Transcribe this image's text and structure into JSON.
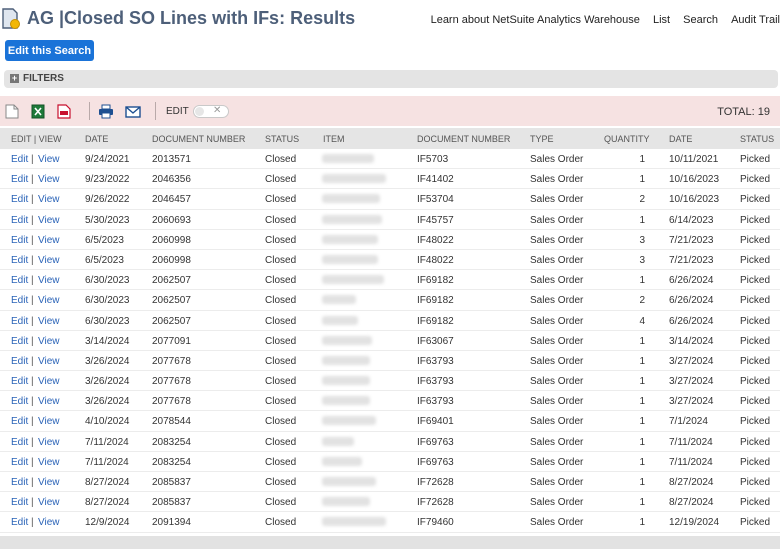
{
  "header": {
    "title": "AG |Closed SO Lines with IFs: Results",
    "links": [
      "Learn about NetSuite Analytics Warehouse",
      "List",
      "Search",
      "Audit Trail"
    ]
  },
  "edit_search_label": "Edit this Search",
  "filters_label": "FILTERS",
  "toolbar": {
    "edit_label": "EDIT",
    "total_label": "TOTAL: 19",
    "icons": [
      "new-page-icon",
      "excel-export-icon",
      "pdf-export-icon",
      "print-icon",
      "email-icon"
    ]
  },
  "columns": [
    "EDIT | VIEW",
    "DATE",
    "DOCUMENT NUMBER",
    "STATUS",
    "ITEM",
    "DOCUMENT NUMBER",
    "TYPE",
    "QUANTITY",
    "DATE",
    "STATUS"
  ],
  "row_edit": "Edit",
  "row_sep": "|",
  "row_view": "View",
  "rows": [
    {
      "date": "9/24/2021",
      "doc": "2013571",
      "status": "Closed",
      "if": "IF5703",
      "type": "Sales Order",
      "qty": "1",
      "date2": "10/11/2021",
      "status2": "Picked"
    },
    {
      "date": "9/23/2022",
      "doc": "2046356",
      "status": "Closed",
      "if": "IF41402",
      "type": "Sales Order",
      "qty": "1",
      "date2": "10/16/2023",
      "status2": "Picked"
    },
    {
      "date": "9/26/2022",
      "doc": "2046457",
      "status": "Closed",
      "if": "IF53704",
      "type": "Sales Order",
      "qty": "2",
      "date2": "10/16/2023",
      "status2": "Picked"
    },
    {
      "date": "5/30/2023",
      "doc": "2060693",
      "status": "Closed",
      "if": "IF45757",
      "type": "Sales Order",
      "qty": "1",
      "date2": "6/14/2023",
      "status2": "Picked"
    },
    {
      "date": "6/5/2023",
      "doc": "2060998",
      "status": "Closed",
      "if": "IF48022",
      "type": "Sales Order",
      "qty": "3",
      "date2": "7/21/2023",
      "status2": "Picked"
    },
    {
      "date": "6/5/2023",
      "doc": "2060998",
      "status": "Closed",
      "if": "IF48022",
      "type": "Sales Order",
      "qty": "3",
      "date2": "7/21/2023",
      "status2": "Picked"
    },
    {
      "date": "6/30/2023",
      "doc": "2062507",
      "status": "Closed",
      "if": "IF69182",
      "type": "Sales Order",
      "qty": "1",
      "date2": "6/26/2024",
      "status2": "Picked"
    },
    {
      "date": "6/30/2023",
      "doc": "2062507",
      "status": "Closed",
      "if": "IF69182",
      "type": "Sales Order",
      "qty": "2",
      "date2": "6/26/2024",
      "status2": "Picked"
    },
    {
      "date": "6/30/2023",
      "doc": "2062507",
      "status": "Closed",
      "if": "IF69182",
      "type": "Sales Order",
      "qty": "4",
      "date2": "6/26/2024",
      "status2": "Picked"
    },
    {
      "date": "3/14/2024",
      "doc": "2077091",
      "status": "Closed",
      "if": "IF63067",
      "type": "Sales Order",
      "qty": "1",
      "date2": "3/14/2024",
      "status2": "Picked"
    },
    {
      "date": "3/26/2024",
      "doc": "2077678",
      "status": "Closed",
      "if": "IF63793",
      "type": "Sales Order",
      "qty": "1",
      "date2": "3/27/2024",
      "status2": "Picked"
    },
    {
      "date": "3/26/2024",
      "doc": "2077678",
      "status": "Closed",
      "if": "IF63793",
      "type": "Sales Order",
      "qty": "1",
      "date2": "3/27/2024",
      "status2": "Picked"
    },
    {
      "date": "3/26/2024",
      "doc": "2077678",
      "status": "Closed",
      "if": "IF63793",
      "type": "Sales Order",
      "qty": "1",
      "date2": "3/27/2024",
      "status2": "Picked"
    },
    {
      "date": "4/10/2024",
      "doc": "2078544",
      "status": "Closed",
      "if": "IF69401",
      "type": "Sales Order",
      "qty": "1",
      "date2": "7/1/2024",
      "status2": "Picked"
    },
    {
      "date": "7/11/2024",
      "doc": "2083254",
      "status": "Closed",
      "if": "IF69763",
      "type": "Sales Order",
      "qty": "1",
      "date2": "7/11/2024",
      "status2": "Picked"
    },
    {
      "date": "7/11/2024",
      "doc": "2083254",
      "status": "Closed",
      "if": "IF69763",
      "type": "Sales Order",
      "qty": "1",
      "date2": "7/11/2024",
      "status2": "Picked"
    },
    {
      "date": "8/27/2024",
      "doc": "2085837",
      "status": "Closed",
      "if": "IF72628",
      "type": "Sales Order",
      "qty": "1",
      "date2": "8/27/2024",
      "status2": "Picked"
    },
    {
      "date": "8/27/2024",
      "doc": "2085837",
      "status": "Closed",
      "if": "IF72628",
      "type": "Sales Order",
      "qty": "1",
      "date2": "8/27/2024",
      "status2": "Picked"
    },
    {
      "date": "12/9/2024",
      "doc": "2091394",
      "status": "Closed",
      "if": "IF79460",
      "type": "Sales Order",
      "qty": "1",
      "date2": "12/19/2024",
      "status2": "Picked"
    }
  ]
}
